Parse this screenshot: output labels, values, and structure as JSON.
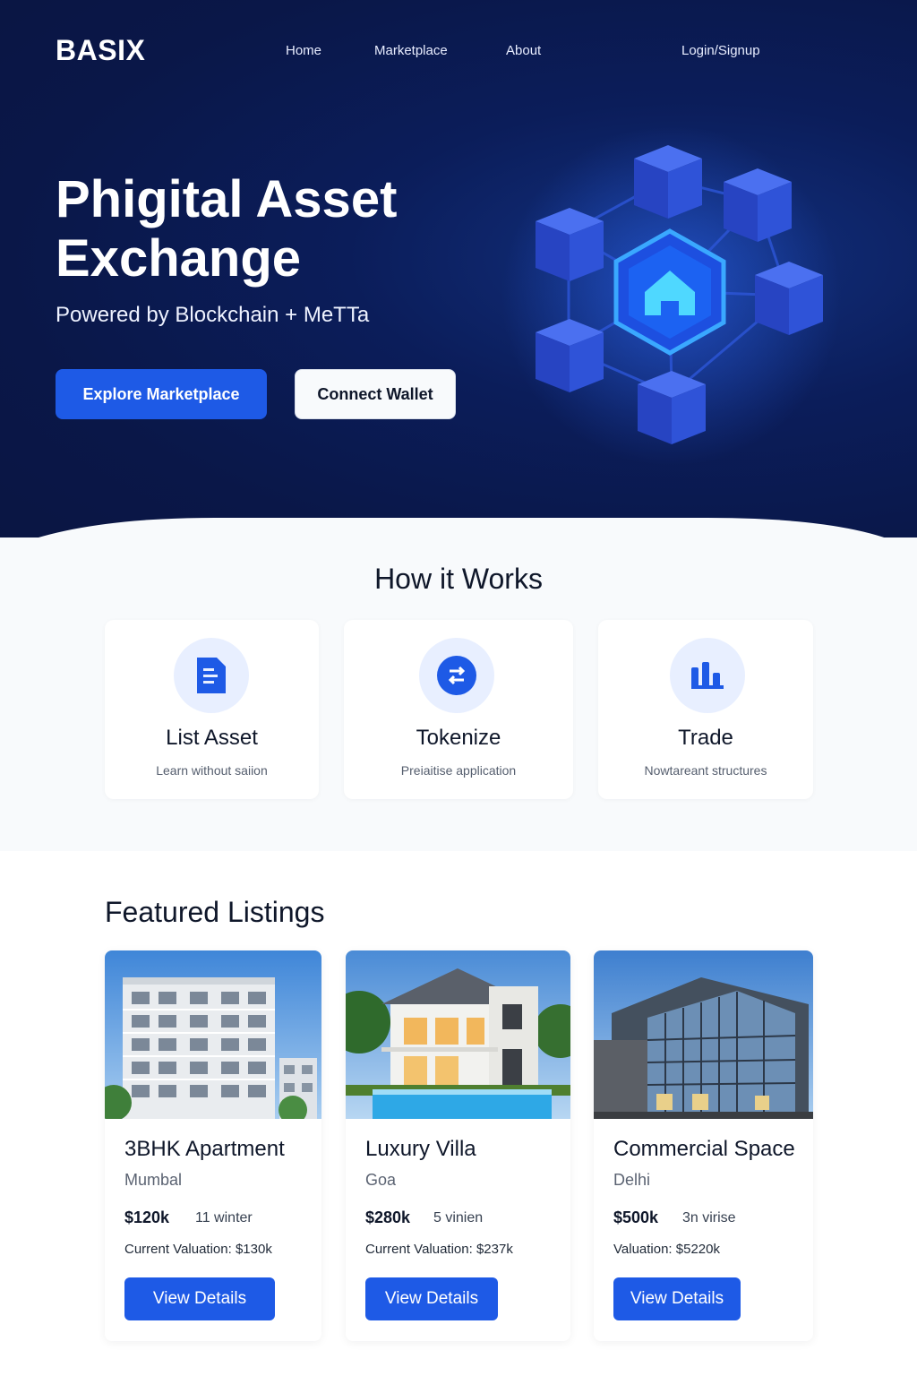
{
  "brand": {
    "logo": "BASIX"
  },
  "nav": {
    "home": "Home",
    "marketplace": "Marketplace",
    "about": "About",
    "login": "Login/Signup"
  },
  "hero": {
    "title": "Phigital Asset Exchange",
    "subtitle": "Powered by Blockchain + MeTTa",
    "primary_button": "Explore Marketplace",
    "secondary_button": "Connect Wallet"
  },
  "how_it_works": {
    "title": "How it Works",
    "steps": [
      {
        "icon": "document-icon",
        "title": "List Asset",
        "description": "Learn without saiion"
      },
      {
        "icon": "token-exchange-icon",
        "title": "Tokenize",
        "description": "Preiaitise application"
      },
      {
        "icon": "chart-bars-icon",
        "title": "Trade",
        "description": "Nowtareant structures"
      }
    ]
  },
  "featured": {
    "title": "Featured Listings",
    "listings": [
      {
        "title": "3BHK Apartment",
        "location": "Mumbal",
        "price": "$120k",
        "extra": "11 winter",
        "valuation": "Current Valuation: $130k",
        "button": "View Details"
      },
      {
        "title": "Luxury Villa",
        "location": "Goa",
        "price": "$280k",
        "extra": "5 vinien",
        "valuation": "Current Valuation: $237k",
        "button": "View Details"
      },
      {
        "title": "Commercial Space",
        "location": "Delhi",
        "price": "$500k",
        "extra": "3n virise",
        "valuation": "Valuation: $5220k",
        "button": "View Details"
      }
    ]
  },
  "colors": {
    "primary": "#1e5ae6",
    "hero_bg": "#0a1748",
    "accent_cyan": "#3ad1ff"
  }
}
